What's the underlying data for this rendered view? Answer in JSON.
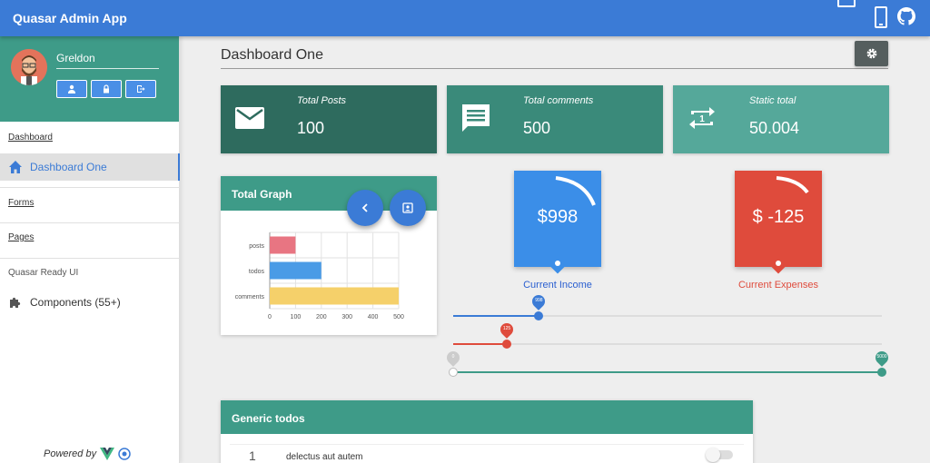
{
  "app": {
    "title": "Quasar Admin App"
  },
  "sidebar": {
    "username": "Greldon",
    "sections": {
      "dashboard": "Dashboard",
      "forms": "Forms",
      "pages": "Pages",
      "ready_ui": "Quasar Ready UI"
    },
    "items": {
      "dashboard_one": "Dashboard One",
      "components": "Components (55+)"
    },
    "footer": "Powered by"
  },
  "page": {
    "title": "Dashboard One"
  },
  "stats": [
    {
      "label": "Total Posts",
      "value": "100",
      "icon": "email-icon",
      "color": "#2e6b5e"
    },
    {
      "label": "Total comments",
      "value": "500",
      "icon": "comment-icon",
      "color": "#3a8a7a"
    },
    {
      "label": "Static total",
      "value": "50.004",
      "icon": "repeat-one-icon",
      "color": "#55a89a"
    }
  ],
  "graph": {
    "title": "Total Graph"
  },
  "chart_data": {
    "type": "bar",
    "orientation": "horizontal",
    "categories": [
      "posts",
      "todos",
      "comments"
    ],
    "values": [
      100,
      200,
      500
    ],
    "colors": [
      "#e87582",
      "#4a9be6",
      "#f5d06a"
    ],
    "xticks": [
      "0",
      "100",
      "200",
      "300",
      "400",
      "500"
    ],
    "xlim": [
      0,
      500
    ],
    "grid": true
  },
  "money": {
    "income": {
      "amount": "$998",
      "label": "Current Income",
      "color": "#3b8ee8",
      "label_color": "#2a5fd0"
    },
    "expenses": {
      "amount": "$ -125",
      "label": "Current Expenses",
      "color": "#df4b3c",
      "label_color": "#df4b3c"
    }
  },
  "sliders": [
    {
      "value": "998",
      "fraction": 0.2,
      "color": "#3b7bd6"
    },
    {
      "value": "125",
      "fraction": 0.125,
      "color": "#df4b3c"
    },
    {
      "min_value": "0",
      "max_value": "5000",
      "min_fraction": 0.0,
      "max_fraction": 1.0,
      "color": "#3e9b88"
    }
  ],
  "todos": {
    "title": "Generic todos",
    "items": [
      {
        "number": "1",
        "text": "delectus aut autem"
      }
    ]
  }
}
